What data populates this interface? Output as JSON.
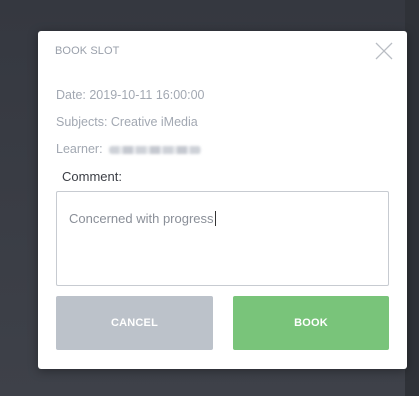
{
  "modal": {
    "title": "BOOK SLOT",
    "date": "Date: 2019-10-11 16:00:00",
    "subjects": "Subjects: Creative iMedia",
    "learner_label": "Learner:",
    "comment_label": "Comment:",
    "comment_value": "Concerned with progress",
    "cancel_label": "CANCEL",
    "book_label": "BOOK",
    "close_icon": "close-icon"
  },
  "colors": {
    "backdrop": "#3a3d45",
    "book_button": "#79c47a",
    "cancel_button": "#bcc2ca"
  }
}
